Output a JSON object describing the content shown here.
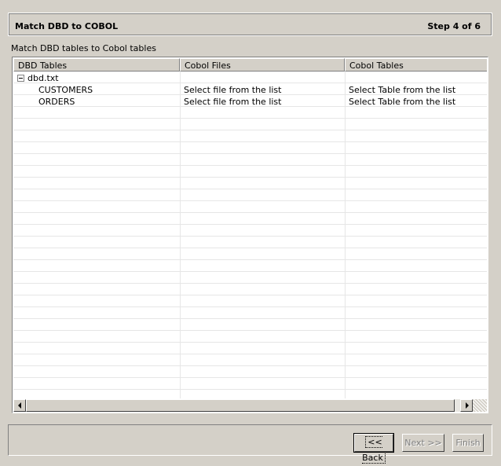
{
  "header": {
    "title": "Match DBD to COBOL",
    "step": "Step 4 of 6"
  },
  "subtitle": "Match DBD tables to Cobol tables",
  "table": {
    "columns": [
      "DBD Tables",
      "Cobol Files",
      "Cobol Tables"
    ],
    "root": {
      "label": "dbd.txt",
      "expanded": true
    },
    "rows": [
      {
        "dbd": "CUSTOMERS",
        "file": "Select file from the list",
        "table": "Select Table from the list"
      },
      {
        "dbd": "ORDERS",
        "file": "Select file from the list",
        "table": "Select Table from the list"
      }
    ]
  },
  "buttons": {
    "back": "<< Back",
    "next": "Next >>",
    "finish": "Finish"
  }
}
